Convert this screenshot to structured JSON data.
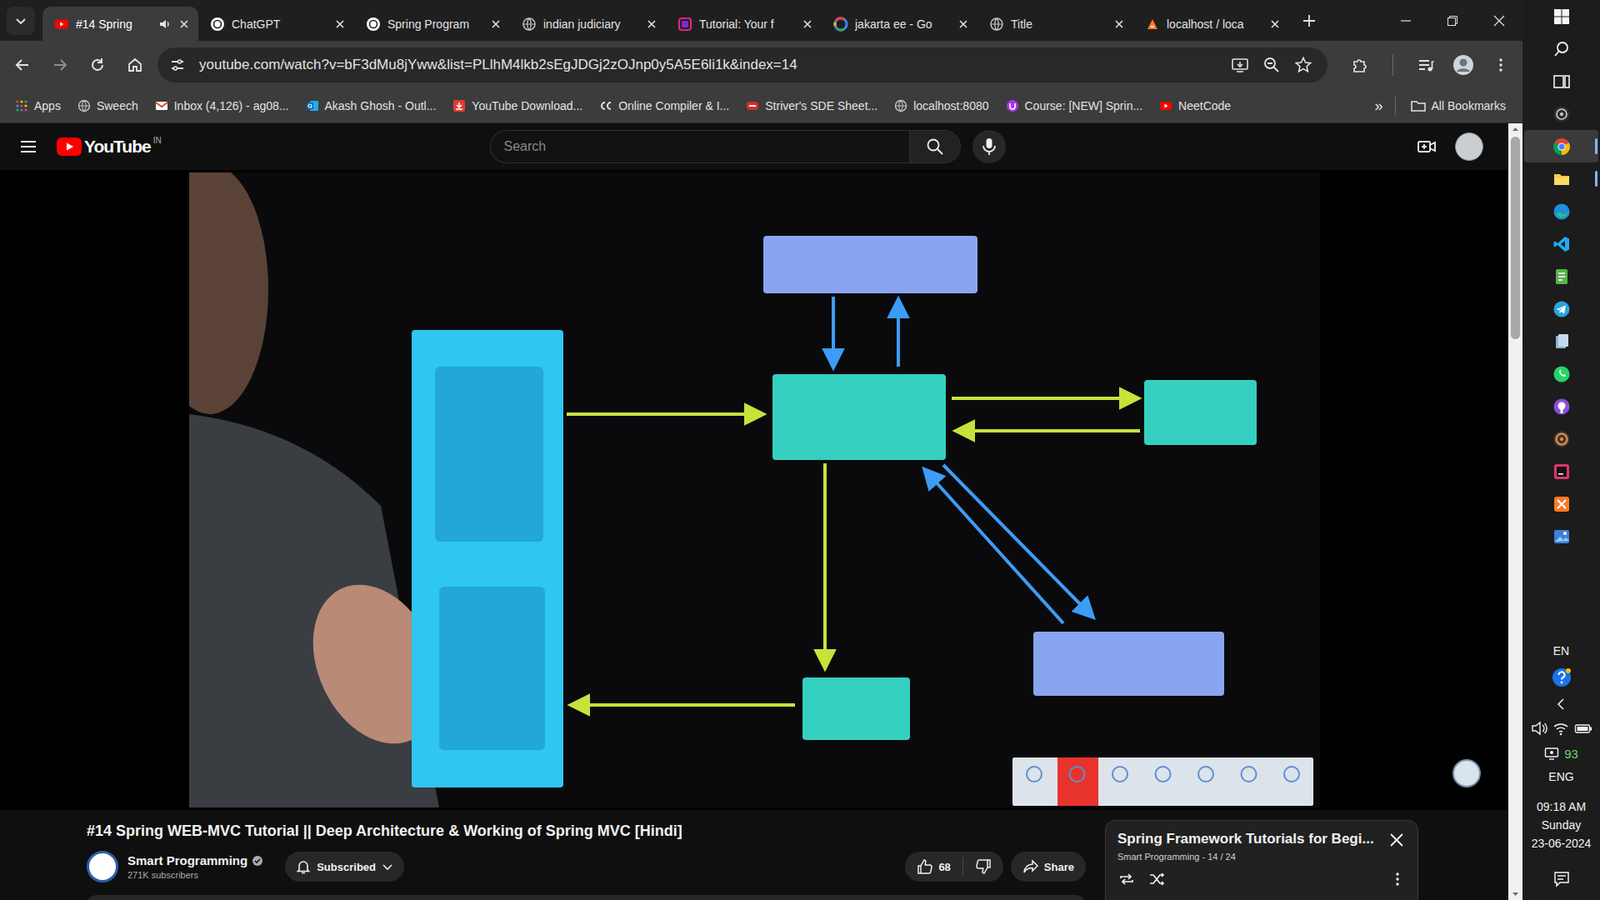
{
  "browser": {
    "tabs": [
      {
        "label": "#14 Spring",
        "selected": true,
        "audio": true,
        "kind": "youtube"
      },
      {
        "label": "ChatGPT",
        "selected": false,
        "audio": false,
        "kind": "chatgpt"
      },
      {
        "label": "Spring Program",
        "selected": false,
        "audio": false,
        "kind": "chatgpt"
      },
      {
        "label": "indian judiciary",
        "selected": false,
        "audio": false,
        "kind": "globe"
      },
      {
        "label": "Tutorial: Your f",
        "selected": false,
        "audio": false,
        "kind": "tutorial"
      },
      {
        "label": "jakarta ee - Go",
        "selected": false,
        "audio": false,
        "kind": "google"
      },
      {
        "label": "Title",
        "selected": false,
        "audio": false,
        "kind": "globe"
      },
      {
        "label": "localhost / loca",
        "selected": false,
        "audio": false,
        "kind": "xampp"
      }
    ],
    "url": "youtube.com/watch?v=bF3dMu8jYww&list=PLlhM4lkb2sEgJDGj2zOJnp0y5A5E6li1k&index=14",
    "bookmarks": [
      {
        "label": "Apps",
        "kind": "apps"
      },
      {
        "label": "Sweech",
        "kind": "globe"
      },
      {
        "label": "Inbox (4,126) - ag08...",
        "kind": "gmail"
      },
      {
        "label": "Akash Ghosh - Outl...",
        "kind": "outlook"
      },
      {
        "label": "YouTube Download...",
        "kind": "download"
      },
      {
        "label": "Online Compiler & I...",
        "kind": "compiler"
      },
      {
        "label": "Striver's SDE Sheet...",
        "kind": "tuf"
      },
      {
        "label": "localhost:8080",
        "kind": "globe"
      },
      {
        "label": "Course: [NEW] Sprin...",
        "kind": "udemy"
      },
      {
        "label": "NeetCode",
        "kind": "youtube"
      }
    ],
    "bookmarks_more": "»",
    "all_bookmarks": "All Bookmarks"
  },
  "youtube": {
    "logo": "YouTube",
    "region": "IN",
    "search": {
      "placeholder": "Search"
    },
    "title": "#14 Spring WEB-MVC Tutorial || Deep Architecture & Working of Spring MVC [Hindi]",
    "channel": {
      "name": "Smart Programming",
      "verified": true,
      "subscribers": "271K subscribers"
    },
    "subscribe": {
      "label": "Subscribed",
      "subscribed": true
    },
    "likes": "68",
    "liked": false,
    "share": "Share",
    "playlist": {
      "title": "Spring Framework Tutorials for Begi...",
      "meta": "Smart Programming - 14 / 24"
    },
    "scrollbar": {
      "level": 0.27
    }
  },
  "taskbar": {
    "apps": [
      {
        "kind": "windows",
        "selected": false,
        "running": false
      },
      {
        "kind": "search",
        "selected": false,
        "running": false
      },
      {
        "kind": "taskview",
        "selected": false,
        "running": false
      },
      {
        "kind": "obs",
        "selected": false,
        "running": false
      },
      {
        "kind": "chrome",
        "selected": true,
        "running": true
      },
      {
        "kind": "explorer",
        "selected": false,
        "running": true
      },
      {
        "kind": "edge",
        "selected": false,
        "running": false
      },
      {
        "kind": "vscode",
        "selected": false,
        "running": false
      },
      {
        "kind": "notepad",
        "selected": false,
        "running": false
      },
      {
        "kind": "telegram",
        "selected": false,
        "running": false
      },
      {
        "kind": "files",
        "selected": false,
        "running": false
      },
      {
        "kind": "whatsapp",
        "selected": false,
        "running": false
      },
      {
        "kind": "github",
        "selected": false,
        "running": false
      },
      {
        "kind": "media",
        "selected": false,
        "running": false
      },
      {
        "kind": "intellij",
        "selected": false,
        "running": false
      },
      {
        "kind": "xampp",
        "selected": false,
        "running": false
      },
      {
        "kind": "photos",
        "selected": false,
        "running": false
      }
    ],
    "language": "EN",
    "battery": "93",
    "input": "ENG",
    "time": "09:18 AM",
    "day": "Sunday",
    "date": "23-06-2024"
  }
}
